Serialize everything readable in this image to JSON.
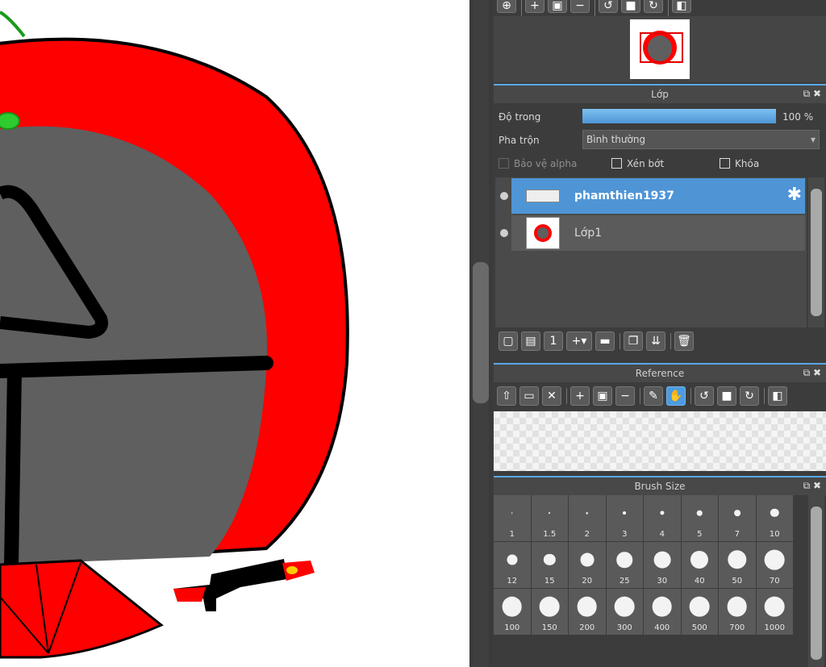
{
  "layer_panel": {
    "title": "Lớp",
    "opacity_label": "Độ trong",
    "opacity_value": "100 %",
    "opacity_fraction": 1.0,
    "blend_label": "Pha trộn",
    "blend_value": "Bình thường",
    "protect_alpha_label": "Bảo vệ alpha",
    "clip_label": "Xén bớt",
    "lock_label": "Khóa",
    "layers": [
      {
        "name": "phamthien1937",
        "selected": true
      },
      {
        "name": "Lớp1",
        "selected": false
      }
    ]
  },
  "reference_panel": {
    "title": "Reference"
  },
  "brush_size_panel": {
    "title": "Brush Size",
    "sizes": [
      "1",
      "1.5",
      "2",
      "3",
      "4",
      "5",
      "7",
      "10",
      "12",
      "15",
      "20",
      "25",
      "30",
      "40",
      "50",
      "70",
      "100",
      "150",
      "200",
      "300",
      "400",
      "500",
      "700",
      "1000"
    ]
  },
  "colors": {
    "accent": "#4f95d6",
    "tomato_red": "#fe0000",
    "gray_body": "#5f5f5f"
  }
}
